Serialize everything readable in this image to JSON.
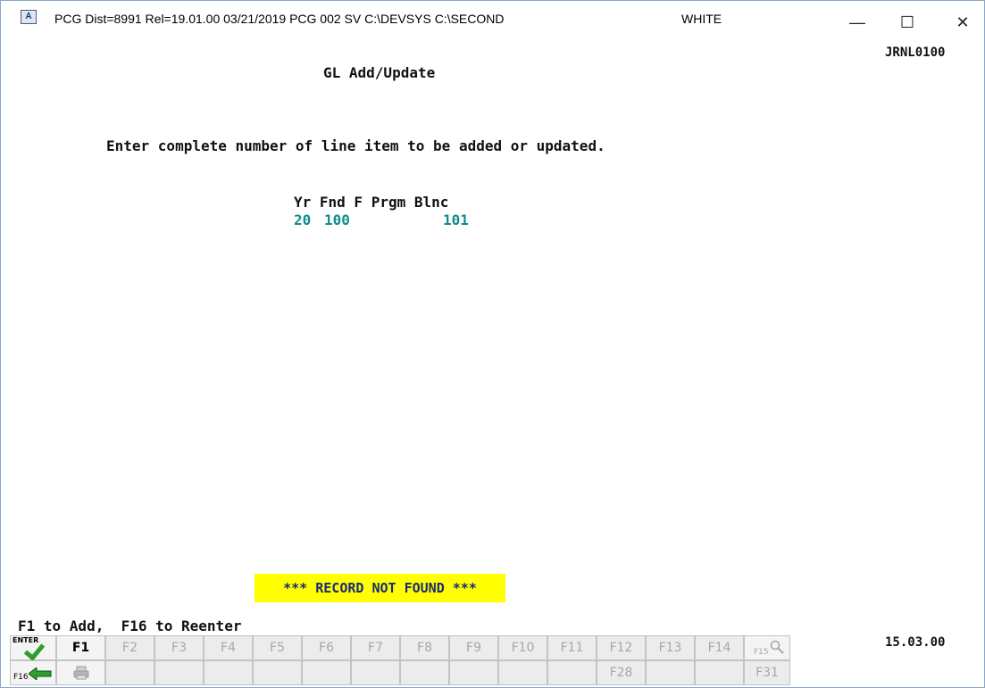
{
  "window": {
    "app_icon": "A",
    "title": "PCG Dist=8991   Rel=19.01.00   03/21/2019   PCG 002   SV   C:\\DEVSYS    C:\\SECOND",
    "user": "WHITE",
    "controls": {
      "minimize": "—",
      "maximize": "☐",
      "close": "✕"
    }
  },
  "screen": {
    "id": "JRNL0100",
    "title": "GL Add/Update",
    "instruction": "Enter complete number of line item to be added or updated.",
    "columns": "Yr Fnd F Prgm Blnc",
    "values": {
      "yr": "20",
      "fnd": "100",
      "blnc": "101"
    },
    "message": "*** RECORD NOT FOUND ***",
    "prompt": "F1 to Add,  F16 to Reenter",
    "time": "15.03.00"
  },
  "fkeys_row1": [
    {
      "label": "ENTER",
      "kind": "enter"
    },
    {
      "label": "F1",
      "kind": "active"
    },
    {
      "label": "F2"
    },
    {
      "label": "F3"
    },
    {
      "label": "F4"
    },
    {
      "label": "F5"
    },
    {
      "label": "F6"
    },
    {
      "label": "F7"
    },
    {
      "label": "F8"
    },
    {
      "label": "F9"
    },
    {
      "label": "F10"
    },
    {
      "label": "F11"
    },
    {
      "label": "F12"
    },
    {
      "label": "F13"
    },
    {
      "label": "F14"
    },
    {
      "label": "F15",
      "kind": "search"
    }
  ],
  "fkeys_row2": [
    {
      "label": "F16",
      "kind": "back"
    },
    {
      "label": "",
      "kind": "print"
    },
    {
      "label": ""
    },
    {
      "label": ""
    },
    {
      "label": ""
    },
    {
      "label": ""
    },
    {
      "label": ""
    },
    {
      "label": ""
    },
    {
      "label": ""
    },
    {
      "label": ""
    },
    {
      "label": ""
    },
    {
      "label": ""
    },
    {
      "label": "F28"
    },
    {
      "label": ""
    },
    {
      "label": ""
    },
    {
      "label": "F31"
    }
  ],
  "icons": {
    "enter": "green-checkmark-icon",
    "f16": "green-back-arrow-icon",
    "print": "printer-icon",
    "f15": "magnifier-icon"
  },
  "colors": {
    "field_value": "#108c8c",
    "banner_bg": "#ffff00",
    "banner_text": "#1a2a7a",
    "check": "#2f9e2f"
  }
}
